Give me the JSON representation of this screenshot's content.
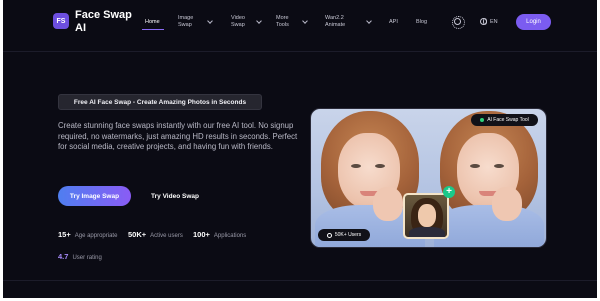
{
  "brand": {
    "badge": "FS",
    "name": "Face Swap AI"
  },
  "nav": {
    "items": [
      {
        "label": "Home",
        "active": true
      },
      {
        "label": "Image Swap",
        "dropdown": true
      },
      {
        "label": "Video Swap",
        "dropdown": true
      },
      {
        "label": "More Tools",
        "dropdown": true
      },
      {
        "label": "Wan2.2 Animate",
        "dropdown": true
      },
      {
        "label": "API"
      },
      {
        "label": "Blog"
      }
    ],
    "theme_icon": "sun-icon",
    "language": "EN",
    "login_label": "Login"
  },
  "hero": {
    "badge": "Free AI Face Swap - Create Amazing Photos in Seconds",
    "description": "Create stunning face swaps instantly with our free AI tool. No signup required, no watermarks, just amazing HD results in seconds. Perfect for social media, creative projects, and having fun with friends.",
    "primary_button": "Try Image Swap",
    "secondary_button": "Try Video Swap",
    "stats": [
      {
        "value": "15+",
        "label": "Age appropriate"
      },
      {
        "value": "50K+",
        "label": "Active users"
      },
      {
        "value": "100+",
        "label": "Applications"
      }
    ],
    "rating": {
      "value": "4.7",
      "label": "User rating"
    },
    "image_tag": "AI Face Swap Tool",
    "users_tag": "50K+ Users"
  },
  "colors": {
    "background": "#0b0b14",
    "accent": "#7b5cf0",
    "gradient_start": "#4f7ef0",
    "gradient_end": "#8a5cf5",
    "success": "#19c98a"
  }
}
